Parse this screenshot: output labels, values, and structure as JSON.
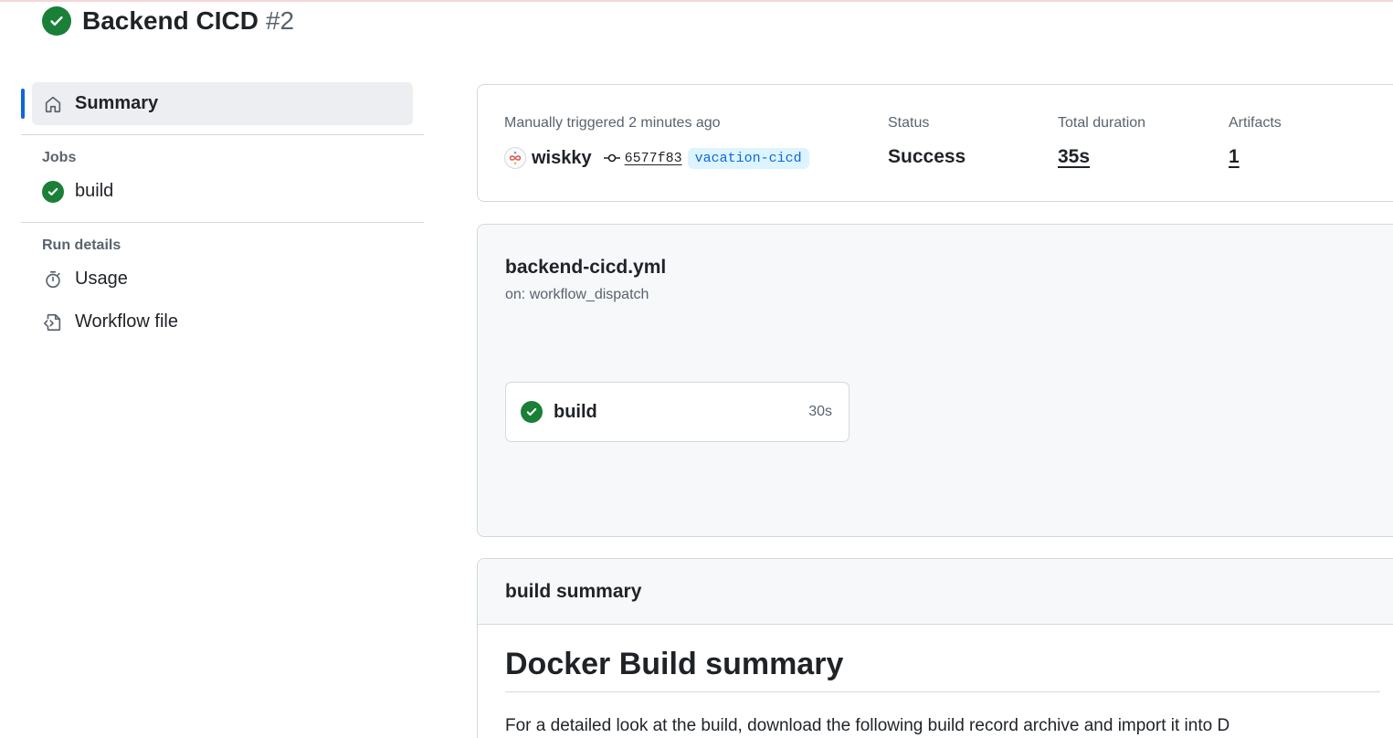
{
  "run": {
    "title": "Backend CICD",
    "number": "#2",
    "status_icon": "check-circle-fill-icon",
    "status_color": "#1a7f37"
  },
  "sidebar": {
    "summary_label": "Summary",
    "jobs_heading": "Jobs",
    "jobs": [
      {
        "label": "build",
        "status": "success"
      }
    ],
    "run_details_heading": "Run details",
    "details": [
      {
        "label": "Usage",
        "icon": "stopwatch-icon"
      },
      {
        "label": "Workflow file",
        "icon": "file-code-icon"
      }
    ],
    "accent_color": "#0969da"
  },
  "summary": {
    "trigger_text": "Manually triggered 2 minutes ago",
    "actor": "wiskky",
    "commit_sha": "6577f83",
    "branch": "vacation-cicd",
    "status_label": "Status",
    "status_value": "Success",
    "duration_label": "Total duration",
    "duration_value": "35s",
    "artifacts_label": "Artifacts",
    "artifacts_value": "1"
  },
  "workflow": {
    "file": "backend-cicd.yml",
    "trigger": "on: workflow_dispatch",
    "jobs": [
      {
        "name": "build",
        "duration": "30s",
        "status": "success"
      }
    ]
  },
  "build_summary": {
    "title": "build summary",
    "heading": "Docker Build summary",
    "text": "For a detailed look at the build, download the following build record archive and import it into D"
  }
}
